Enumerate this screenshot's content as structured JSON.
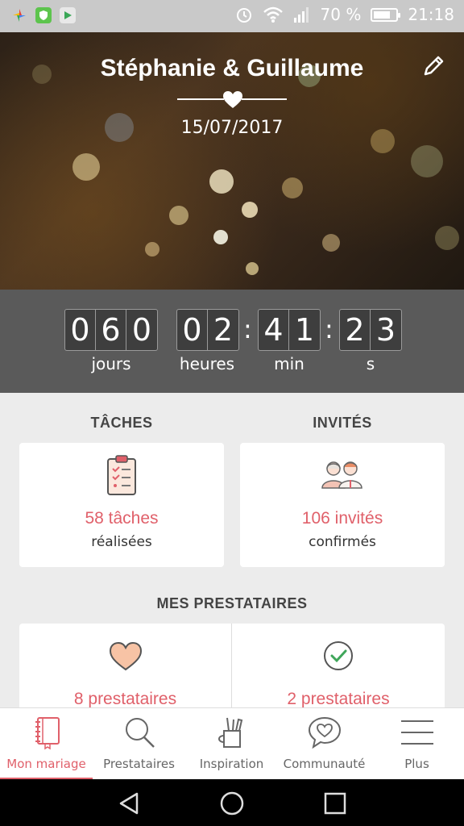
{
  "status_bar": {
    "battery": "70 %",
    "time": "21:18",
    "battery_level": 0.7
  },
  "hero": {
    "title": "Stéphanie & Guillaume",
    "date": "15/07/2017"
  },
  "countdown": {
    "days_digits": [
      "0",
      "6",
      "0"
    ],
    "hours_digits": [
      "0",
      "2"
    ],
    "min_digits": [
      "4",
      "1"
    ],
    "sec_digits": [
      "2",
      "3"
    ],
    "labels": {
      "days": "jours",
      "hours": "heures",
      "min": "min",
      "sec": "s"
    }
  },
  "tasks": {
    "heading": "TÂCHES",
    "count": "58 tâches",
    "sub": "réalisées"
  },
  "guests": {
    "heading": "INVITÉS",
    "count": "106 invités",
    "sub": "confirmés"
  },
  "vendors": {
    "heading": "MES PRESTATAIRES",
    "left_count": "8 prestataires",
    "right_count": "2 prestataires"
  },
  "bottom_nav": {
    "items": [
      {
        "label": "Mon mariage",
        "icon": "notebook-icon",
        "active": true
      },
      {
        "label": "Prestataires",
        "icon": "search-icon",
        "active": false
      },
      {
        "label": "Inspiration",
        "icon": "tools-cup-icon",
        "active": false
      },
      {
        "label": "Communauté",
        "icon": "chat-heart-icon",
        "active": false
      },
      {
        "label": "Plus",
        "icon": "menu-icon",
        "active": false
      }
    ]
  },
  "colors": {
    "accent": "#e0606a",
    "countdown_bg": "#5a5a5a"
  }
}
